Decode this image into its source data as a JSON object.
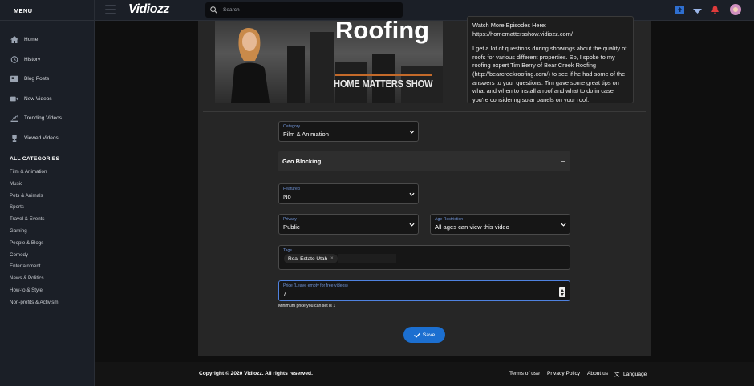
{
  "sidebar": {
    "menu_label": "MENU",
    "items": [
      {
        "label": "Home",
        "icon": "home-icon"
      },
      {
        "label": "History",
        "icon": "clock-icon"
      },
      {
        "label": "Blog Posts",
        "icon": "newspaper-icon"
      },
      {
        "label": "New Videos",
        "icon": "video-camera-icon"
      },
      {
        "label": "Trending Videos",
        "icon": "trending-icon"
      },
      {
        "label": "Viewed Videos",
        "icon": "trophy-icon"
      }
    ],
    "categories_title": "ALL CATEGORIES",
    "categories": [
      "Film & Animation",
      "Music",
      "Pets & Animals",
      "Sports",
      "Travel & Events",
      "Gaming",
      "People & Blogs",
      "Comedy",
      "Entertainment",
      "News & Politics",
      "How-to & Style",
      "Non-profits & Activism"
    ]
  },
  "header": {
    "logo": "Vidiozz",
    "search_placeholder": "Search"
  },
  "video": {
    "thumb_title": "Roofing",
    "thumb_subtitle": "HOME MATTERS SHOW",
    "description_p1": "Watch More Episodes Here: https://homemattersshow.vidiozz.com/",
    "description_p2": "I get a lot of questions during showings about the quality of roofs for various different properties. So, I spoke to my roofing expert Tim Berry of Bear Creek Roofing (http://bearcreekroofing.com/) to see if he had some of the answers to your questions. Tim gave some great tips on what and when to install a roof and what to do in case you're considering solar panels on your roof."
  },
  "form": {
    "category": {
      "label": "Category",
      "value": "Film & Animation"
    },
    "geo_blocking": {
      "label": "Geo Blocking"
    },
    "featured": {
      "label": "Featured",
      "value": "No"
    },
    "privacy": {
      "label": "Privacy",
      "value": "Public"
    },
    "age_restriction": {
      "label": "Age Restriction",
      "value": "All ages can view this video"
    },
    "tags": {
      "label": "Tags",
      "chips": [
        "Real Estate Utah"
      ]
    },
    "price": {
      "label": "Price (Leave empty for free videos)",
      "value": "7",
      "hint": "Minimum price you can set is 1"
    },
    "save_label": "Save"
  },
  "footer": {
    "copyright": "Copyright © 2020 Vidiozz. All rights reserved.",
    "links": [
      "Terms of use",
      "Privacy Policy",
      "About us",
      "Language"
    ]
  },
  "colors": {
    "accent": "#1c6fd0",
    "label_blue": "#6f93d6",
    "sidebar_bg": "#1b1f27"
  }
}
